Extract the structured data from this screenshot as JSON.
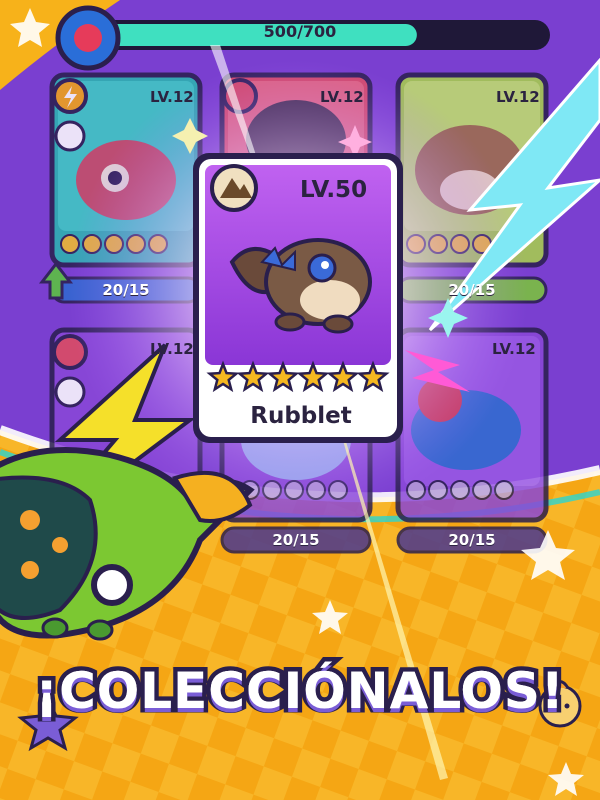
{
  "xp_bar": {
    "value_text": "500/700",
    "current": 500,
    "max": 700,
    "fill_color": "#3fe0c0"
  },
  "cards": [
    {
      "level": "LV.12",
      "element": "lightning-icon",
      "progress": "20/15",
      "upgrade_available": true
    },
    {
      "level": "LV.12",
      "element": "fire-icon"
    },
    {
      "level": "LV.12",
      "element": "",
      "progress": "20/15"
    },
    {
      "level": "LV.12",
      "element": "fire-icon"
    },
    {
      "level": "",
      "element": "",
      "progress": "20/15"
    },
    {
      "level": "LV.12",
      "element": "",
      "progress": "20/15"
    }
  ],
  "featured": {
    "level": "LV.50",
    "name": "Rubblet",
    "stars": 6,
    "element": "mountain-icon",
    "card_color": "#b04de6"
  },
  "banner": {
    "text": "¡COLECCIÓNALOS!"
  },
  "colors": {
    "purple_bg": "#7a3fd0",
    "orange_bg": "#f5a614",
    "dark_outline": "#2a1f4d"
  }
}
